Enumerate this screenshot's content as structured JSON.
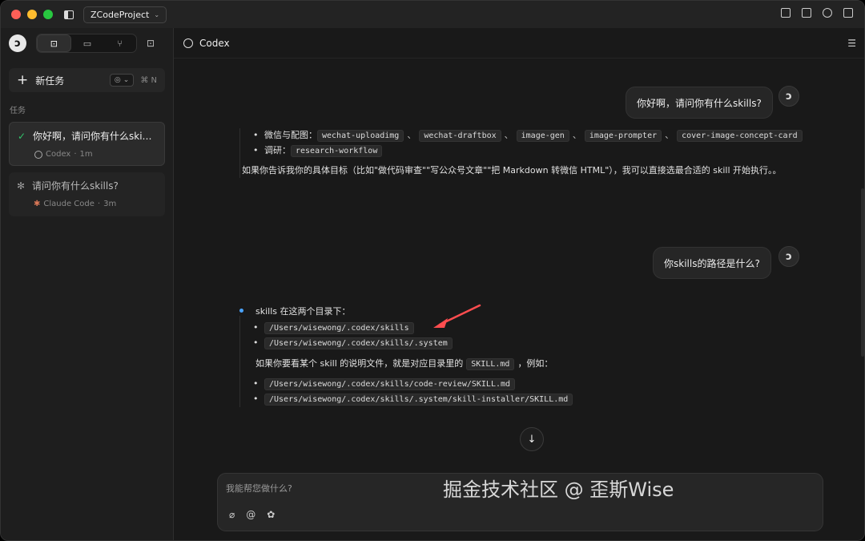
{
  "titlebar": {
    "project": "ZCodeProject"
  },
  "sidebar": {
    "new_task_label": "新任务",
    "new_task_shortcut": "⌘ N",
    "section_label": "任务",
    "tasks": [
      {
        "title": "你好啊，请问你有什么skills?",
        "agent": "Codex",
        "time": "1m",
        "status": "done"
      },
      {
        "title": "请问你有什么skills?",
        "agent": "Claude Code",
        "time": "3m",
        "status": "running"
      }
    ]
  },
  "main": {
    "header_title": "Codex",
    "messages": {
      "user1": "你好啊，请问你有什么skills?",
      "reply1": {
        "bullets": [
          {
            "label": "微信与配图：",
            "codes": [
              "wechat-uploadimg",
              "wechat-draftbox",
              "image-gen",
              "image-prompter",
              "cover-image-concept-card"
            ]
          },
          {
            "label": "调研：",
            "codes": [
              "research-workflow"
            ]
          }
        ],
        "para": "如果你告诉我你的具体目标（比如\"做代码审查\"\"写公众号文章\"\"把 Markdown 转微信 HTML\"），我可以直接选最合适的 skill 开始执行。。"
      },
      "user2": "你skills的路径是什么?",
      "reply2": {
        "intro": "skills 在这两个目录下：",
        "dirs": [
          "/Users/wisewong/.codex/skills",
          "/Users/wisewong/.codex/skills/.system"
        ],
        "para_before": "如果你要看某个 skill 的说明文件，就是对应目录里的",
        "para_code": "SKILL.md",
        "para_after": "，例如：",
        "examples": [
          "/Users/wisewong/.codex/skills/code-review/SKILL.md",
          "/Users/wisewong/.codex/skills/.system/skill-installer/SKILL.md"
        ]
      }
    },
    "composer_placeholder": "我能帮您做什么?"
  },
  "watermark": "掘金技术社区 @ 歪斯Wise",
  "colors": {
    "check": "#31c36a",
    "arrow": "#ff4d4f",
    "dot": "#4aa3ff"
  }
}
